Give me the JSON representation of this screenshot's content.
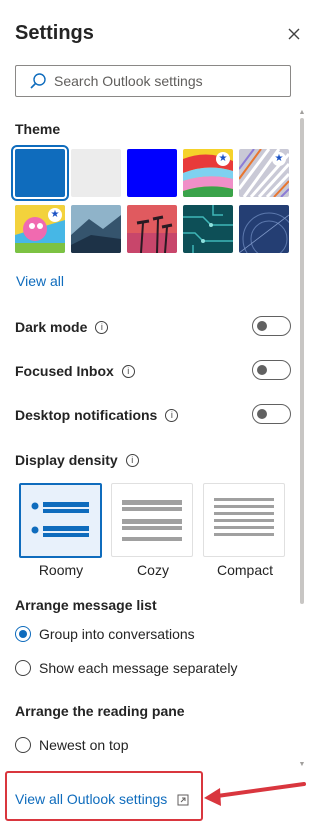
{
  "header": {
    "title": "Settings",
    "close_icon": "close-icon"
  },
  "search": {
    "placeholder": "Search Outlook settings",
    "icon": "search-icon"
  },
  "theme": {
    "heading": "Theme",
    "view_all": "View all",
    "accent": "#0f6cbd",
    "swatches": [
      {
        "name": "blue",
        "color": "#0f6cbd",
        "selected": true
      },
      {
        "name": "light-gray",
        "color": "#ececec"
      },
      {
        "name": "bright-blue",
        "color": "#0000ff"
      },
      {
        "name": "rainbow",
        "starred": true
      },
      {
        "name": "lines",
        "starred": true
      },
      {
        "name": "cartoon",
        "starred": true
      },
      {
        "name": "mountain"
      },
      {
        "name": "palms"
      },
      {
        "name": "circuit"
      },
      {
        "name": "aviation"
      }
    ]
  },
  "toggles": {
    "dark_mode": {
      "label": "Dark mode",
      "on": false
    },
    "focused_inbox": {
      "label": "Focused Inbox",
      "on": false
    },
    "desktop_notifications": {
      "label": "Desktop notifications",
      "on": false
    },
    "info_icon": "info-icon"
  },
  "density": {
    "heading": "Display density",
    "options": [
      {
        "label": "Roomy",
        "selected": true
      },
      {
        "label": "Cozy",
        "selected": false
      },
      {
        "label": "Compact",
        "selected": false
      }
    ]
  },
  "arrange_list": {
    "heading": "Arrange message list",
    "options": [
      {
        "label": "Group into conversations",
        "selected": true
      },
      {
        "label": "Show each message separately",
        "selected": false
      }
    ]
  },
  "reading_pane": {
    "heading": "Arrange the reading pane",
    "options": [
      {
        "label": "Newest on top",
        "selected": false
      }
    ]
  },
  "footer": {
    "view_all_link": "View all Outlook settings",
    "external_icon": "open-in-new-window-icon",
    "highlight_color": "#d9363e"
  }
}
